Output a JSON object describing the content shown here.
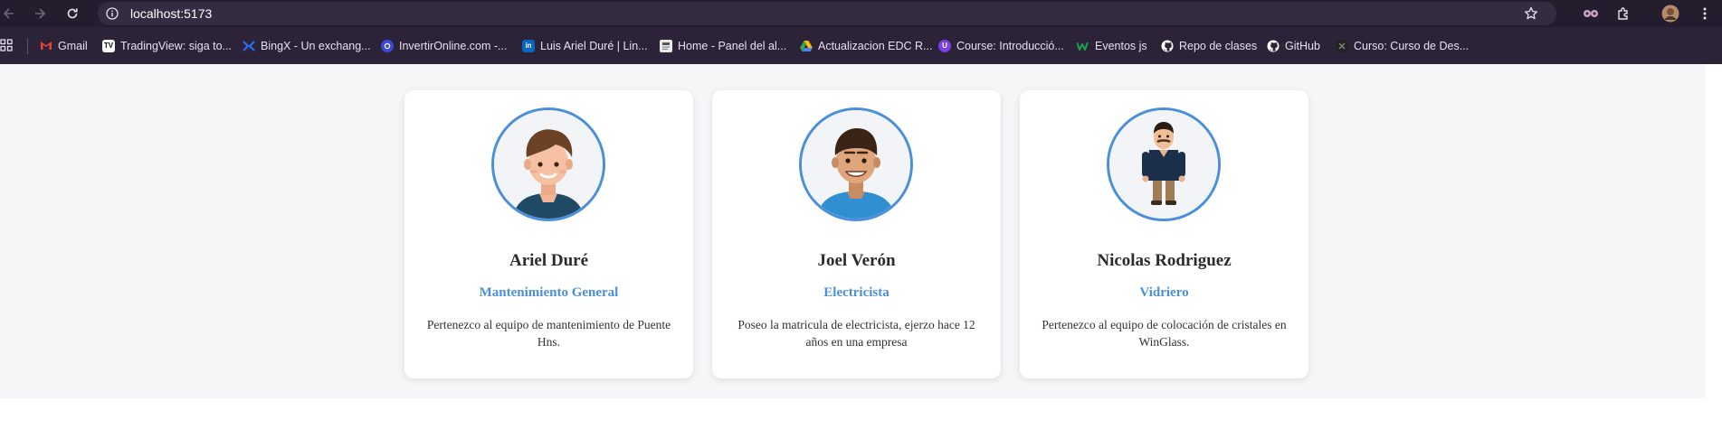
{
  "browser": {
    "url": "localhost:5173"
  },
  "bookmarks": [
    {
      "label": "Gmail",
      "icon": "gmail-icon",
      "color": "#ea4335"
    },
    {
      "label": "TradingView: siga to...",
      "icon": "tradingview-icon",
      "color": "#111111"
    },
    {
      "label": "BingX - Un exchang...",
      "icon": "bingx-icon",
      "color": "#2a6df4"
    },
    {
      "label": "InvertirOnline.com -...",
      "icon": "invertironline-icon",
      "color": "#3b4bd8"
    },
    {
      "label": "Luis Ariel Duré | Lin...",
      "icon": "linkedin-icon",
      "color": "#0a66c2"
    },
    {
      "label": "Home - Panel del al...",
      "icon": "panel-icon",
      "color": "#dddddd"
    },
    {
      "label": "Actualizacion EDC R...",
      "icon": "drive-icon",
      "color": "#34a853"
    },
    {
      "label": "Course: Introducció...",
      "icon": "course-icon",
      "color": "#7b3fe4"
    },
    {
      "label": "Eventos js",
      "icon": "eventos-icon",
      "color": "#16a34a"
    },
    {
      "label": "Repo de clases",
      "icon": "github-icon",
      "color": "#ffffff"
    },
    {
      "label": "GitHub",
      "icon": "github-icon",
      "color": "#ffffff"
    },
    {
      "label": "Curso: Curso de Des...",
      "icon": "curso-icon",
      "color": "#222222"
    }
  ],
  "team": [
    {
      "name": "Ariel Duré",
      "role": "Mantenimiento General",
      "description": "Pertenezco al equipo de mantenimiento de Puente Hns."
    },
    {
      "name": "Joel Verón",
      "role": "Electricista",
      "description": "Poseo la matricula de electricista, ejerzo hace 12 años en una empresa"
    },
    {
      "name": "Nicolas Rodriguez",
      "role": "Vidriero",
      "description": "Pertenezco al equipo de colocación de cristales en WinGlass."
    }
  ],
  "colors": {
    "accent": "#4a8fdb",
    "name_text": "#2b2b2b",
    "page_bg": "#f6f6f9"
  }
}
